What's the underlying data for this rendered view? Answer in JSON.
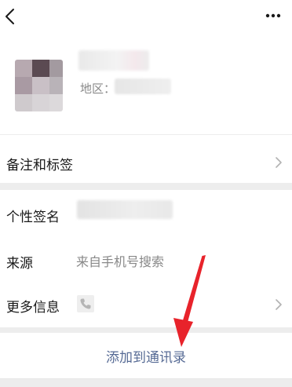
{
  "header": {
    "back_icon": "back-chevron-icon",
    "more_icon": "more-dots-icon"
  },
  "profile": {
    "region_label": "地区："
  },
  "rows": {
    "remark_label": "备注和标签",
    "signature_label": "个性签名",
    "source_label": "来源",
    "source_value": "来自手机号搜索",
    "more_info_label": "更多信息"
  },
  "actions": {
    "add_to_contacts": "添加到通讯录"
  },
  "colors": {
    "link": "#576b95",
    "annotation_arrow": "#e8232b"
  }
}
